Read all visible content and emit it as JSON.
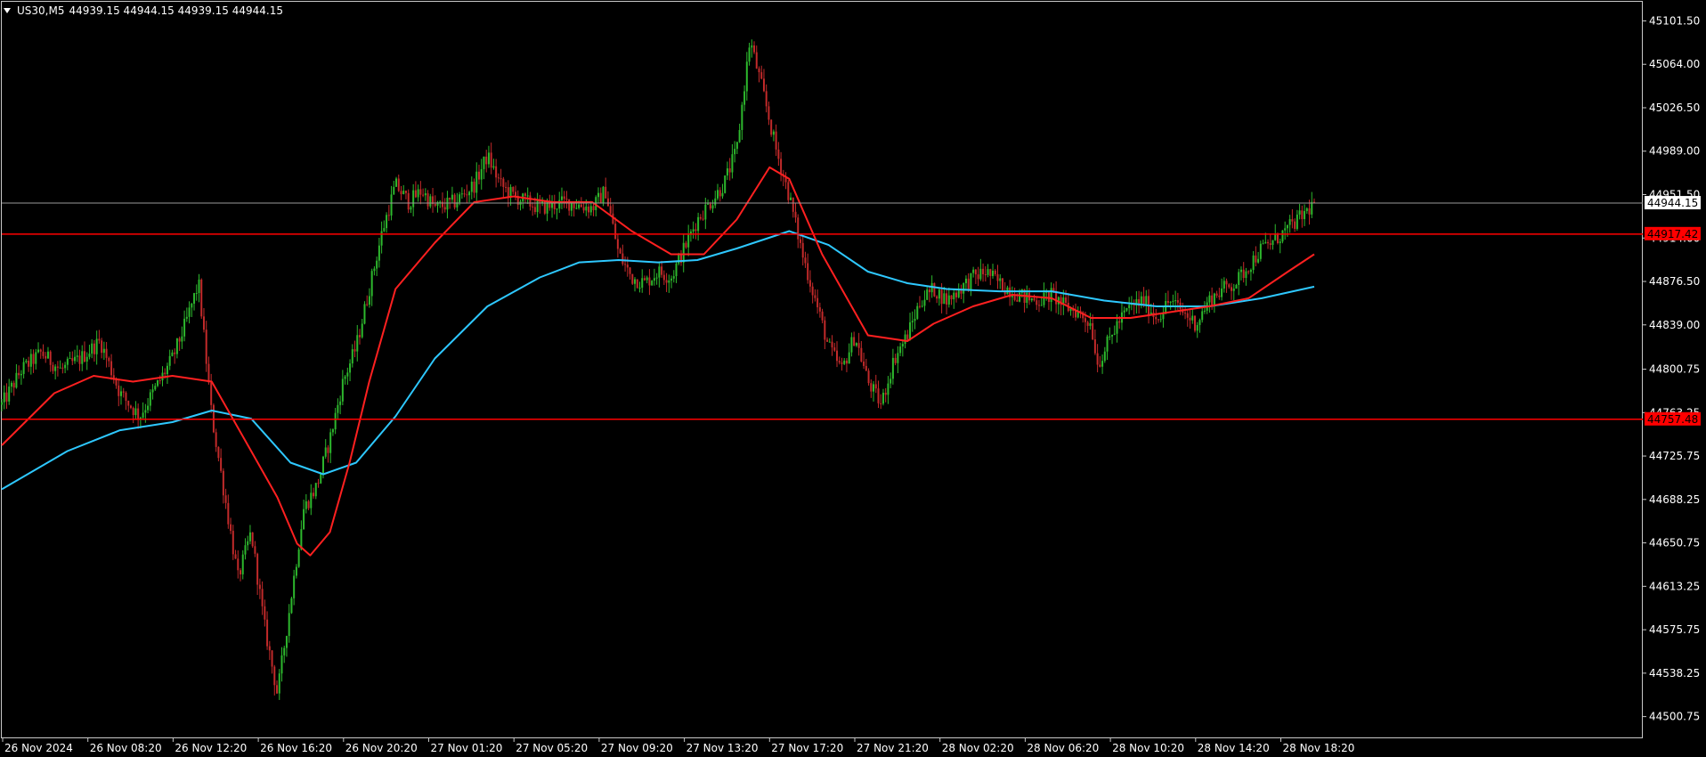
{
  "symbol": "US30,M5",
  "ohlc": "44939.15 44944.15 44939.15 44944.15",
  "colors": {
    "background": "#000000",
    "up_candle": "#2db82d",
    "down_candle": "#c22a2a",
    "ma_fast": "#ff2020",
    "ma_slow": "#2ec8ff",
    "level_line": "#ff0000",
    "bid_line": "#9a9a9a",
    "axis_text": "#ffffff",
    "frame": "#c8c8c8"
  },
  "chart_data": {
    "type": "candlestick",
    "title": "US30,M5",
    "ylim": [
      44482,
      45118
    ],
    "y_ticks": [
      "45101.50",
      "45064.00",
      "45026.50",
      "44989.00",
      "44951.50",
      "44914.00",
      "44876.50",
      "44839.00",
      "44800.75",
      "44763.25",
      "44725.75",
      "44688.25",
      "44650.75",
      "44613.25",
      "44575.75",
      "44538.25",
      "44500.75"
    ],
    "x_tick_labels": [
      "26 Nov 2024",
      "26 Nov 08:20",
      "26 Nov 12:20",
      "26 Nov 16:20",
      "26 Nov 20:20",
      "27 Nov 01:20",
      "27 Nov 05:20",
      "27 Nov 09:20",
      "27 Nov 13:20",
      "27 Nov 17:20",
      "27 Nov 21:20",
      "28 Nov 02:20",
      "28 Nov 06:20",
      "28 Nov 10:20",
      "28 Nov 14:20",
      "28 Nov 18:20"
    ],
    "current_price": 44944.15,
    "current_price_label": "44944.15",
    "horizontal_levels": [
      {
        "value": 44917.42,
        "label": "44917.42"
      },
      {
        "value": 44757.48,
        "label": "44757.48"
      }
    ],
    "price_path": [
      {
        "t": 0,
        "p": 44770
      },
      {
        "t": 0.015,
        "p": 44800
      },
      {
        "t": 0.03,
        "p": 44815
      },
      {
        "t": 0.045,
        "p": 44800
      },
      {
        "t": 0.06,
        "p": 44810
      },
      {
        "t": 0.075,
        "p": 44825
      },
      {
        "t": 0.09,
        "p": 44780
      },
      {
        "t": 0.105,
        "p": 44760
      },
      {
        "t": 0.12,
        "p": 44790
      },
      {
        "t": 0.13,
        "p": 44810
      },
      {
        "t": 0.14,
        "p": 44840
      },
      {
        "t": 0.15,
        "p": 44875
      },
      {
        "t": 0.16,
        "p": 44760
      },
      {
        "t": 0.17,
        "p": 44690
      },
      {
        "t": 0.18,
        "p": 44620
      },
      {
        "t": 0.19,
        "p": 44660
      },
      {
        "t": 0.2,
        "p": 44580
      },
      {
        "t": 0.21,
        "p": 44520
      },
      {
        "t": 0.22,
        "p": 44600
      },
      {
        "t": 0.23,
        "p": 44680
      },
      {
        "t": 0.24,
        "p": 44700
      },
      {
        "t": 0.25,
        "p": 44740
      },
      {
        "t": 0.26,
        "p": 44790
      },
      {
        "t": 0.27,
        "p": 44820
      },
      {
        "t": 0.28,
        "p": 44870
      },
      {
        "t": 0.29,
        "p": 44920
      },
      {
        "t": 0.3,
        "p": 44960
      },
      {
        "t": 0.31,
        "p": 44945
      },
      {
        "t": 0.32,
        "p": 44955
      },
      {
        "t": 0.33,
        "p": 44940
      },
      {
        "t": 0.345,
        "p": 44945
      },
      {
        "t": 0.36,
        "p": 44960
      },
      {
        "t": 0.37,
        "p": 44985
      },
      {
        "t": 0.38,
        "p": 44960
      },
      {
        "t": 0.39,
        "p": 44950
      },
      {
        "t": 0.41,
        "p": 44940
      },
      {
        "t": 0.43,
        "p": 44945
      },
      {
        "t": 0.45,
        "p": 44940
      },
      {
        "t": 0.46,
        "p": 44955
      },
      {
        "t": 0.47,
        "p": 44900
      },
      {
        "t": 0.48,
        "p": 44880
      },
      {
        "t": 0.49,
        "p": 44875
      },
      {
        "t": 0.5,
        "p": 44885
      },
      {
        "t": 0.51,
        "p": 44880
      },
      {
        "t": 0.52,
        "p": 44905
      },
      {
        "t": 0.53,
        "p": 44930
      },
      {
        "t": 0.54,
        "p": 44945
      },
      {
        "t": 0.55,
        "p": 44960
      },
      {
        "t": 0.56,
        "p": 44990
      },
      {
        "t": 0.57,
        "p": 45085
      },
      {
        "t": 0.58,
        "p": 45040
      },
      {
        "t": 0.59,
        "p": 44990
      },
      {
        "t": 0.6,
        "p": 44950
      },
      {
        "t": 0.61,
        "p": 44900
      },
      {
        "t": 0.62,
        "p": 44860
      },
      {
        "t": 0.63,
        "p": 44820
      },
      {
        "t": 0.64,
        "p": 44800
      },
      {
        "t": 0.65,
        "p": 44830
      },
      {
        "t": 0.66,
        "p": 44790
      },
      {
        "t": 0.67,
        "p": 44770
      },
      {
        "t": 0.68,
        "p": 44810
      },
      {
        "t": 0.69,
        "p": 44830
      },
      {
        "t": 0.7,
        "p": 44860
      },
      {
        "t": 0.71,
        "p": 44870
      },
      {
        "t": 0.72,
        "p": 44860
      },
      {
        "t": 0.73,
        "p": 44870
      },
      {
        "t": 0.74,
        "p": 44880
      },
      {
        "t": 0.75,
        "p": 44885
      },
      {
        "t": 0.76,
        "p": 44875
      },
      {
        "t": 0.77,
        "p": 44868
      },
      {
        "t": 0.78,
        "p": 44862
      },
      {
        "t": 0.79,
        "p": 44860
      },
      {
        "t": 0.8,
        "p": 44865
      },
      {
        "t": 0.81,
        "p": 44855
      },
      {
        "t": 0.82,
        "p": 44850
      },
      {
        "t": 0.83,
        "p": 44840
      },
      {
        "t": 0.835,
        "p": 44805
      },
      {
        "t": 0.85,
        "p": 44840
      },
      {
        "t": 0.86,
        "p": 44855
      },
      {
        "t": 0.87,
        "p": 44860
      },
      {
        "t": 0.88,
        "p": 44845
      },
      {
        "t": 0.89,
        "p": 44860
      },
      {
        "t": 0.9,
        "p": 44850
      },
      {
        "t": 0.91,
        "p": 44840
      },
      {
        "t": 0.92,
        "p": 44860
      },
      {
        "t": 0.93,
        "p": 44870
      },
      {
        "t": 0.94,
        "p": 44875
      },
      {
        "t": 0.95,
        "p": 44890
      },
      {
        "t": 0.96,
        "p": 44905
      },
      {
        "t": 0.97,
        "p": 44912
      },
      {
        "t": 0.98,
        "p": 44922
      },
      {
        "t": 0.99,
        "p": 44932
      },
      {
        "t": 1,
        "p": 44944
      }
    ],
    "fast_ma": [
      {
        "t": 0,
        "p": 44735
      },
      {
        "t": 0.04,
        "p": 44780
      },
      {
        "t": 0.07,
        "p": 44795
      },
      {
        "t": 0.1,
        "p": 44790
      },
      {
        "t": 0.13,
        "p": 44795
      },
      {
        "t": 0.16,
        "p": 44790
      },
      {
        "t": 0.19,
        "p": 44730
      },
      {
        "t": 0.21,
        "p": 44690
      },
      {
        "t": 0.225,
        "p": 44650
      },
      {
        "t": 0.235,
        "p": 44640
      },
      {
        "t": 0.25,
        "p": 44660
      },
      {
        "t": 0.265,
        "p": 44720
      },
      {
        "t": 0.28,
        "p": 44790
      },
      {
        "t": 0.3,
        "p": 44870
      },
      {
        "t": 0.33,
        "p": 44910
      },
      {
        "t": 0.36,
        "p": 44945
      },
      {
        "t": 0.39,
        "p": 44950
      },
      {
        "t": 0.42,
        "p": 44945
      },
      {
        "t": 0.45,
        "p": 44945
      },
      {
        "t": 0.48,
        "p": 44920
      },
      {
        "t": 0.51,
        "p": 44900
      },
      {
        "t": 0.535,
        "p": 44900
      },
      {
        "t": 0.56,
        "p": 44930
      },
      {
        "t": 0.585,
        "p": 44975
      },
      {
        "t": 0.6,
        "p": 44965
      },
      {
        "t": 0.625,
        "p": 44900
      },
      {
        "t": 0.66,
        "p": 44830
      },
      {
        "t": 0.69,
        "p": 44825
      },
      {
        "t": 0.71,
        "p": 44840
      },
      {
        "t": 0.74,
        "p": 44855
      },
      {
        "t": 0.77,
        "p": 44865
      },
      {
        "t": 0.8,
        "p": 44862
      },
      {
        "t": 0.83,
        "p": 44845
      },
      {
        "t": 0.86,
        "p": 44845
      },
      {
        "t": 0.89,
        "p": 44850
      },
      {
        "t": 0.92,
        "p": 44855
      },
      {
        "t": 0.95,
        "p": 44862
      },
      {
        "t": 0.98,
        "p": 44885
      },
      {
        "t": 1,
        "p": 44900
      }
    ],
    "slow_ma": [
      {
        "t": 0,
        "p": 44697
      },
      {
        "t": 0.05,
        "p": 44730
      },
      {
        "t": 0.09,
        "p": 44748
      },
      {
        "t": 0.13,
        "p": 44755
      },
      {
        "t": 0.16,
        "p": 44765
      },
      {
        "t": 0.19,
        "p": 44758
      },
      {
        "t": 0.22,
        "p": 44720
      },
      {
        "t": 0.245,
        "p": 44710
      },
      {
        "t": 0.27,
        "p": 44720
      },
      {
        "t": 0.3,
        "p": 44760
      },
      {
        "t": 0.33,
        "p": 44810
      },
      {
        "t": 0.37,
        "p": 44855
      },
      {
        "t": 0.41,
        "p": 44880
      },
      {
        "t": 0.44,
        "p": 44893
      },
      {
        "t": 0.47,
        "p": 44895
      },
      {
        "t": 0.5,
        "p": 44893
      },
      {
        "t": 0.53,
        "p": 44895
      },
      {
        "t": 0.56,
        "p": 44905
      },
      {
        "t": 0.6,
        "p": 44920
      },
      {
        "t": 0.63,
        "p": 44908
      },
      {
        "t": 0.66,
        "p": 44885
      },
      {
        "t": 0.69,
        "p": 44875
      },
      {
        "t": 0.72,
        "p": 44870
      },
      {
        "t": 0.76,
        "p": 44868
      },
      {
        "t": 0.8,
        "p": 44868
      },
      {
        "t": 0.84,
        "p": 44860
      },
      {
        "t": 0.88,
        "p": 44855
      },
      {
        "t": 0.92,
        "p": 44855
      },
      {
        "t": 0.96,
        "p": 44862
      },
      {
        "t": 1,
        "p": 44872
      }
    ]
  }
}
